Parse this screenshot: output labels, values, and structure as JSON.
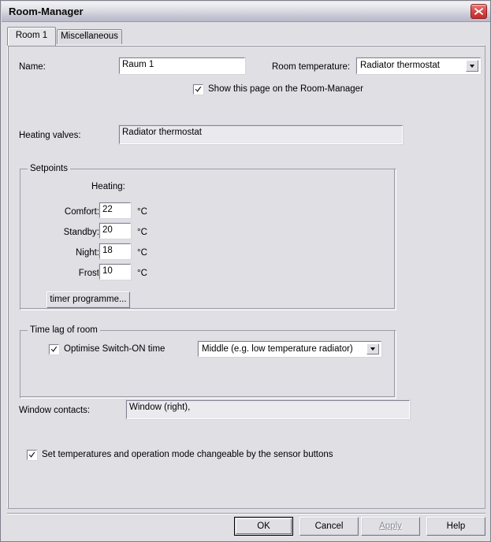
{
  "window": {
    "title": "Room-Manager",
    "close_icon": "close-icon"
  },
  "tabs": [
    {
      "label": "Room 1",
      "active": true
    },
    {
      "label": "Miscellaneous",
      "active": false
    }
  ],
  "form": {
    "name_label": "Name:",
    "name_value": "Raum 1",
    "room_temperature_label": "Room temperature:",
    "room_temperature_value": "Radiator thermostat",
    "show_page_checkbox_label": "Show this page on the Room-Manager",
    "show_page_checked": true,
    "heating_valves_label": "Heating valves:",
    "heating_valves_value": "Radiator thermostat",
    "window_contacts_label": "Window contacts:",
    "window_contacts_value": "Window  (right),",
    "sensor_buttons_checkbox_label": "Set temperatures and operation mode changeable by the sensor buttons",
    "sensor_buttons_checked": true
  },
  "setpoints": {
    "group_title": "Setpoints",
    "column_header": "Heating:",
    "unit": "°C",
    "rows": [
      {
        "label": "Comfort:",
        "value": "22"
      },
      {
        "label": "Standby:",
        "value": "20"
      },
      {
        "label": "Night:",
        "value": "18"
      },
      {
        "label": "Frost",
        "value": "10"
      }
    ],
    "timer_button": "timer programme..."
  },
  "time_lag": {
    "group_title": "Time lag of room",
    "optimise_checkbox_label": "Optimise Switch-ON time",
    "optimise_checked": true,
    "mode_value": "Middle (e.g. low temperature radiator)"
  },
  "footer": {
    "ok": "OK",
    "cancel": "Cancel",
    "apply": "Apply",
    "apply_enabled": false,
    "help": "Help"
  },
  "colors": {
    "dialog_face": "#dfdfe4",
    "close_button": "#c22d2d",
    "disabled_text": "#8b8b97"
  }
}
